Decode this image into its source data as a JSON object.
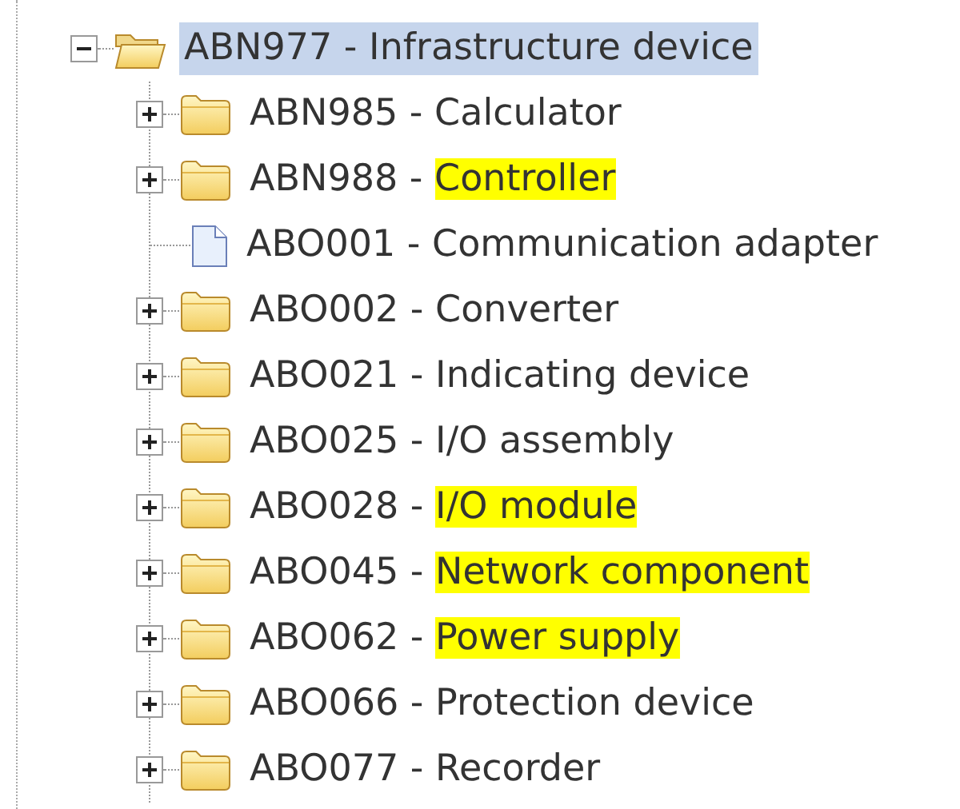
{
  "tree": [
    {
      "kind": "folder",
      "code": "ABN977 -",
      "name": "Infrastructure device",
      "expanded": true,
      "selected": true,
      "highlighted": false,
      "children": [
        {
          "kind": "folder",
          "code": "ABN985 -",
          "name": "Calculator",
          "expanded": false,
          "selected": false,
          "highlighted": false
        },
        {
          "kind": "folder",
          "code": "ABN988 -",
          "name": "Controller",
          "expanded": false,
          "selected": false,
          "highlighted": true
        },
        {
          "kind": "document",
          "code": "ABO001 -",
          "name": "Communication adapter",
          "selected": false,
          "highlighted": false
        },
        {
          "kind": "folder",
          "code": "ABO002 -",
          "name": "Converter",
          "expanded": false,
          "selected": false,
          "highlighted": false
        },
        {
          "kind": "folder",
          "code": "ABO021 -",
          "name": "Indicating device",
          "expanded": false,
          "selected": false,
          "highlighted": false
        },
        {
          "kind": "folder",
          "code": "ABO025 -",
          "name": "I/O assembly",
          "expanded": false,
          "selected": false,
          "highlighted": false
        },
        {
          "kind": "folder",
          "code": "ABO028 -",
          "name": "I/O module",
          "expanded": false,
          "selected": false,
          "highlighted": true
        },
        {
          "kind": "folder",
          "code": "ABO045 -",
          "name": "Network component",
          "expanded": false,
          "selected": false,
          "highlighted": true
        },
        {
          "kind": "folder",
          "code": "ABO062 -",
          "name": "Power supply",
          "expanded": false,
          "selected": false,
          "highlighted": true
        },
        {
          "kind": "folder",
          "code": "ABO066 -",
          "name": "Protection device",
          "expanded": false,
          "selected": false,
          "highlighted": false
        },
        {
          "kind": "folder",
          "code": "ABO077 -",
          "name": "Recorder",
          "expanded": false,
          "selected": false,
          "highlighted": false
        }
      ]
    }
  ]
}
